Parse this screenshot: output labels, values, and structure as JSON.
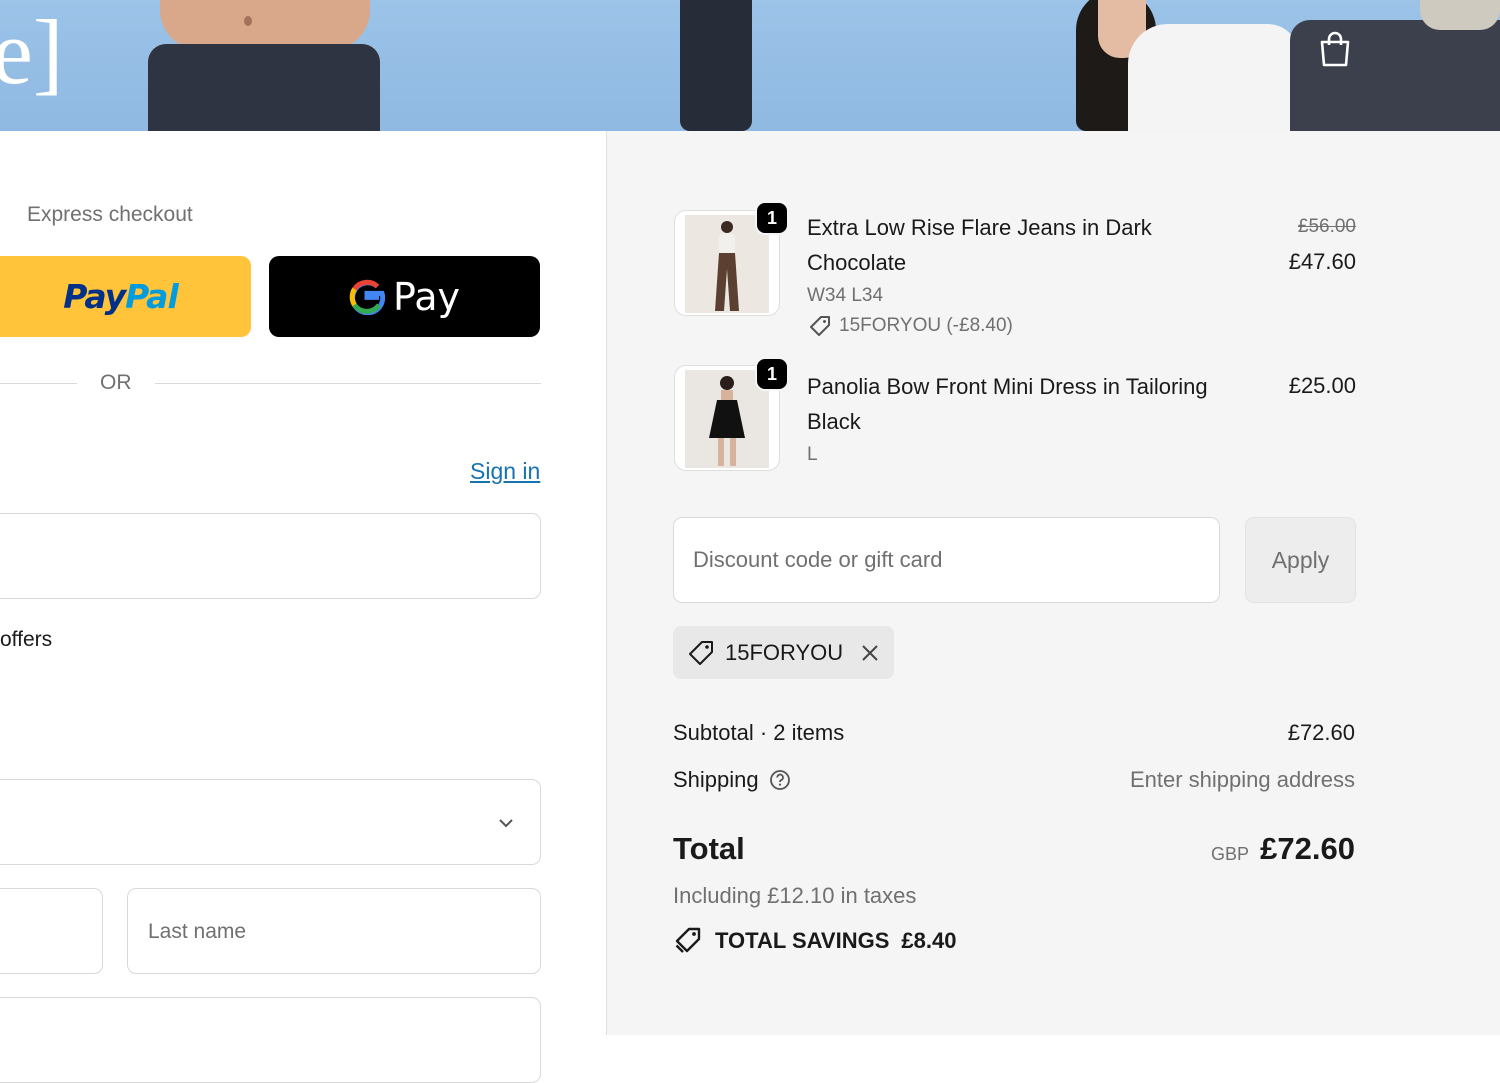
{
  "left": {
    "express_checkout": "Express checkout",
    "paypal": {
      "part1": "Pay",
      "part2": "Pal"
    },
    "gpay": {
      "g": "G",
      "label": "Pay"
    },
    "or": "OR",
    "sign_in": "Sign in",
    "offers_text": "offers",
    "last_name_placeholder": "Last name"
  },
  "cart": {
    "items": [
      {
        "name_line1": "Extra Low Rise Flare Jeans in Dark",
        "name_line2": "Chocolate",
        "variant": "W34 L34",
        "discount": "15FORYOU (-£8.40)",
        "quantity": "1",
        "original_price": "£56.00",
        "price": "£47.60"
      },
      {
        "name_line1": "Panolia Bow Front Mini Dress in Tailoring",
        "name_line2": "Black",
        "variant": "L",
        "quantity": "1",
        "price": "£25.00"
      }
    ],
    "discount_placeholder": "Discount code or gift card",
    "apply_label": "Apply",
    "applied_code": "15FORYOU",
    "subtotal_label": "Subtotal · 2 items",
    "subtotal_value": "£72.60",
    "shipping_label": "Shipping",
    "shipping_value": "Enter shipping address",
    "total_label": "Total",
    "total_currency": "GBP",
    "total_value": "£72.60",
    "tax_text": "Including £12.10 in taxes",
    "savings_label": "TOTAL SAVINGS",
    "savings_value": "£8.40"
  },
  "colors": {
    "paypal_bg": "#ffc43a",
    "link": "#1773b0",
    "summary_bg": "#f5f5f5"
  }
}
